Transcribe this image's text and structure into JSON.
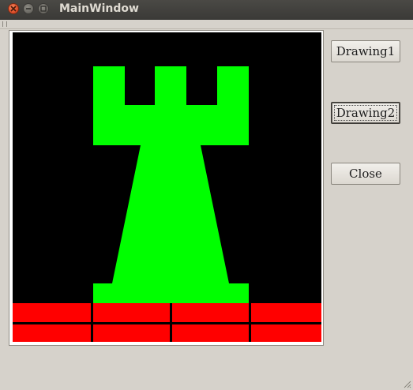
{
  "window": {
    "title": "MainWindow"
  },
  "buttons": {
    "drawing1": "Drawing1",
    "drawing2": "Drawing2",
    "close": "Close"
  },
  "canvas": {
    "background": "#000000",
    "shape_color": "#00ff00",
    "brick_color": "#ff0000",
    "drawing": "rook-tower-on-brick-wall"
  },
  "colors": {
    "titlebar": "#3b3a37",
    "window_bg": "#d6d2cb"
  }
}
